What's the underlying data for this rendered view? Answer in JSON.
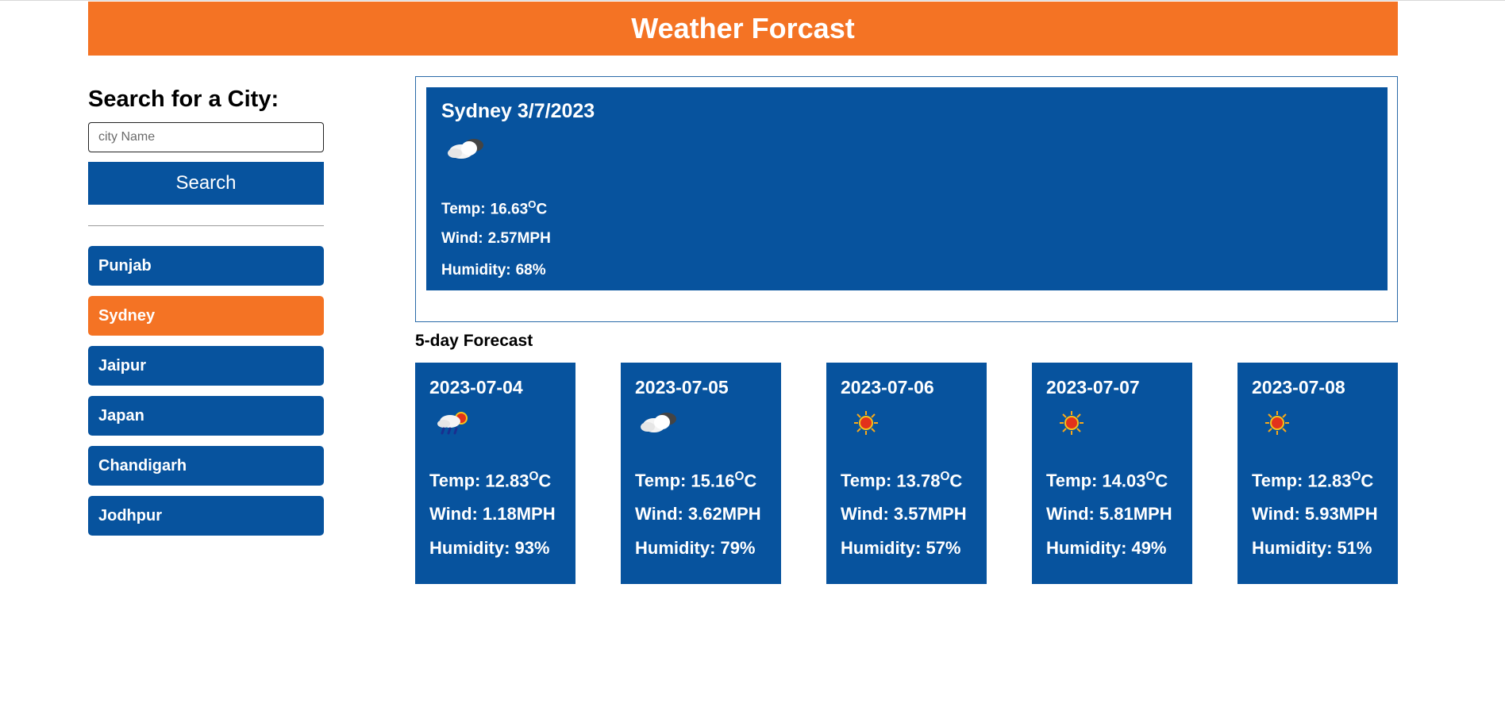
{
  "header": {
    "title": "Weather Forcast"
  },
  "sidebar": {
    "heading": "Search for a City:",
    "search_placeholder": "city Name",
    "search_button": "Search",
    "history": [
      {
        "label": "Punjab",
        "active": false
      },
      {
        "label": "Sydney",
        "active": true
      },
      {
        "label": "Jaipur",
        "active": false
      },
      {
        "label": "Japan",
        "active": false
      },
      {
        "label": "Chandigarh",
        "active": false
      },
      {
        "label": "Jodhpur",
        "active": false
      }
    ]
  },
  "current": {
    "city_date": "Sydney 3/7/2023",
    "icon": "cloud-icon",
    "temp_label": "Temp:",
    "temp_value": "16.63",
    "temp_unit_sup": "O",
    "temp_unit": "C",
    "wind_label": "Wind:",
    "wind_value": "2.57MPH",
    "humidity_label": "Humidity:",
    "humidity_value": "68%"
  },
  "forecast": {
    "title": "5-day Forecast",
    "days": [
      {
        "date": "2023-07-04",
        "icon": "rain-sun-icon",
        "temp": "12.83",
        "wind": "1.18MPH",
        "humidity": "93%"
      },
      {
        "date": "2023-07-05",
        "icon": "cloud-icon",
        "temp": "15.16",
        "wind": "3.62MPH",
        "humidity": "79%"
      },
      {
        "date": "2023-07-06",
        "icon": "sun-icon",
        "temp": "13.78",
        "wind": "3.57MPH",
        "humidity": "57%"
      },
      {
        "date": "2023-07-07",
        "icon": "sun-icon",
        "temp": "14.03",
        "wind": "5.81MPH",
        "humidity": "49%"
      },
      {
        "date": "2023-07-08",
        "icon": "sun-icon",
        "temp": "12.83",
        "wind": "5.93MPH",
        "humidity": "51%"
      }
    ],
    "temp_label": "Temp:",
    "wind_label": "Wind:",
    "humidity_label": "Humidity:",
    "temp_unit_sup": "O",
    "temp_unit": "C"
  },
  "colors": {
    "accent_orange": "#f47324",
    "primary_blue": "#07539e"
  }
}
